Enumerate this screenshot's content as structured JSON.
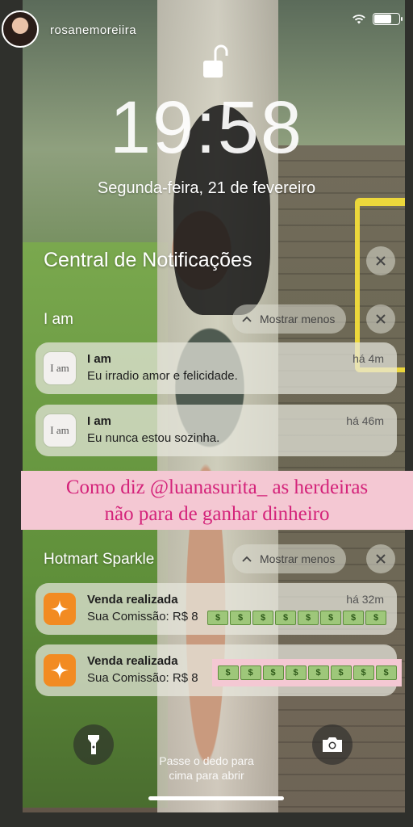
{
  "status_bar": {
    "username": "rosanemoreiira",
    "icons": [
      "avatar",
      "wifi-icon",
      "battery-icon"
    ]
  },
  "lock_screen": {
    "lock_icon": "unlocked-padlock-icon",
    "time": "19:58",
    "date": "Segunda-feira, 21 de fevereiro"
  },
  "notification_center": {
    "title": "Central de Notificações",
    "clear_icon": "close-icon",
    "groups": [
      {
        "app": "I am",
        "collapse_label": "Mostrar menos",
        "notifications": [
          {
            "icon_text": "I am",
            "title": "I am",
            "body": "Eu irradio amor e felicidade.",
            "time": "há 4m"
          },
          {
            "icon_text": "I am",
            "title": "I am",
            "body": "Eu nunca estou sozinha.",
            "time": "há 46m"
          }
        ]
      },
      {
        "app": "Hotmart Sparkle",
        "collapse_label": "Mostrar menos",
        "notifications": [
          {
            "icon": "sparkle-icon",
            "title": "Venda realizada",
            "body": "Sua Comissão: R$ 8",
            "time": "há 32m"
          },
          {
            "icon": "sparkle-icon",
            "title": "Venda realizada",
            "body": "Sua Comissão: R$ 8",
            "time": ""
          }
        ]
      }
    ]
  },
  "story_caption": {
    "line1": "Como diz @luanasurita_ as herdeiras",
    "line2": "não para de ganhar dinheiro"
  },
  "bill_label": "$",
  "bottom": {
    "flashlight_icon": "flashlight-icon",
    "camera_icon": "camera-icon",
    "hint_line1": "Passe o dedo para",
    "hint_line2": "cima para abrir"
  },
  "colors": {
    "caption_bg": "#f4c8d3",
    "caption_text": "#d4237a",
    "sparkle_orange": "#f28b22"
  }
}
